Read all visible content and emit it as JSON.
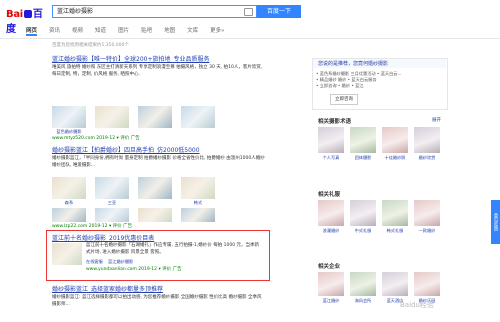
{
  "header": {
    "logo_left": "Bai",
    "logo_right": "百度",
    "query": "蓝江婚纱摄影",
    "search_button": "百度一下"
  },
  "tabs": [
    "网页",
    "资讯",
    "视频",
    "知道",
    "图片",
    "贴吧",
    "地图",
    "文库",
    "更多»"
  ],
  "result_count": "百度为您找到相关结果约1,350,000个",
  "results": [
    {
      "title": "蓝江婚纱摄影【唯一特价】全球200+旅拍地_专业品质服务",
      "desc": "唯美风 旅拍特 婚纱照 东区主打清新天系列 专享定制浪漫至尊 拍摄风格，独立 30 天, 拍10人，客片欣赏, 每日定制, 特，定制, 价风格 服务, 晒照中心.",
      "url": "www.mtyz520.com  2019-12  ▾  评价  广告",
      "caps": [
        "蓝色婚纱摄影",
        "",
        "",
        ""
      ]
    },
    {
      "title": "婚纱摄影蓝江【拍爵婚纱】四旦高手拍_仿2000低5000",
      "desc": "婚纱摄影蓝江，「半同身份,拥有时尚 量身定制 拍爵婚纱摄影 价格全省性价比, 拍爵婚纱 由温州1000人婚纱婚纱团队, 唯爱摄影...",
      "url": "www.lzp22.com  2019-12  ▾  评价  广告",
      "caps": [
        "森系",
        "三亚",
        "",
        "韩式"
      ]
    },
    {
      "title": "蓝江前十名婚纱摄影_2019优惠价目表",
      "desc": "蓝江前十名婚纱摄影「石湖婚礼」作应专属, 五行拍摄-1,婚纱价 每拍 1000 元，当季新式片场, 进入婚纱摄影 风景全景 客照。",
      "url": "www.yundaanlian.com  2019-12  ▾  评价  广告",
      "caps": [
        "在线客服",
        "蓝江婚纱摄影",
        "",
        ""
      ]
    },
    {
      "title": "婚纱摄影蓝江_选择蓝家婚纱都量多顶推荐",
      "desc": "婚纱摄影蓝江: 蓝江选择摄影都可以拍出动感, 为您推荐婚纱摄影 全国婚纱摄影 性价比高 婚纱摄影 全季风 摄影师...",
      "url": "",
      "caps": []
    }
  ],
  "right": {
    "ad_title": "您说的是推荐，您竟何婚纱摄影",
    "ad_lines": [
      "• 蓝色系婚纱摄影  三月优惠活动  • 蓝天白云...",
      "• 精品婚纱  婚纱 • 蓝天白云服务",
      "• 立即咨询 • 婚纱 • 蓝江"
    ],
    "ad_button": "立即咨询",
    "section1_title": "相关摄影术语",
    "section1_more": "展开",
    "section1_items": [
      "个人写真",
      "团体摄影",
      "十佳婚纱照",
      "婚纱欣赏"
    ],
    "section2_title": "相关礼服",
    "section2_items": [
      "浪漫婚纱",
      "中式礼服",
      "韩式礼服",
      "一款婚纱"
    ],
    "section3_title": "相关企业",
    "section3_items": [
      "蓝江婚纱",
      "海风会所",
      "蓝天酒店",
      "婚纱乐园"
    ],
    "feedback": "意见反馈"
  },
  "watermark": "Baidu经验"
}
